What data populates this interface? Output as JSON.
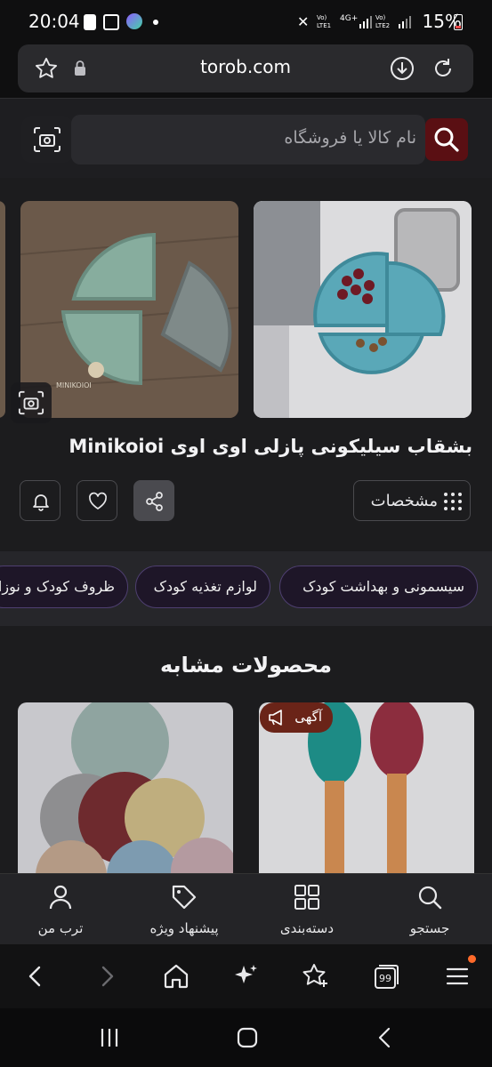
{
  "status_bar": {
    "time": "20:04",
    "battery": "15%",
    "sim1_label": "Vo) LTE1",
    "sim2_label": "Vo) LTE2",
    "net_label": "4G+"
  },
  "browser": {
    "url": "torob.com"
  },
  "search": {
    "placeholder": "نام کالا یا فروشگاه",
    "brand_color": "#5a0f13"
  },
  "product": {
    "title": "بشقاب سیلیکونی پازلی اوی اوی Minikoioi",
    "specs_label": "مشخصات",
    "image_caption": "MINIKOIOI"
  },
  "category_chips": [
    "سیسمونی و بهداشت کودک",
    "لوازم تغذیه کودک",
    "ظروف کودک و نوزاد"
  ],
  "similar": {
    "title": "محصولات مشابه",
    "ad_badge": "آگهی"
  },
  "bottom_nav": {
    "search": "جستجو",
    "categories": "دسته‌بندی",
    "offers": "پیشنهاد ویژه",
    "profile": "ترب من"
  },
  "browser_toolbar": {
    "tabs_count": "99"
  },
  "colors": {
    "chip_border": "#4e3f70",
    "ad_badge": "#6a2418"
  }
}
